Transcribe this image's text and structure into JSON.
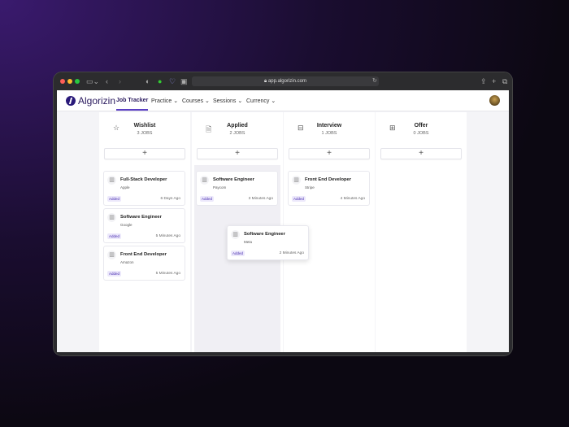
{
  "browser": {
    "url": "app.algorizin.com"
  },
  "nav": {
    "brand": "Algorizin",
    "items": [
      {
        "label": "Job Tracker"
      },
      {
        "label": "Practice ⌄"
      },
      {
        "label": "Courses ⌄"
      },
      {
        "label": "Sessions ⌄"
      },
      {
        "label": "Currency ⌄"
      }
    ]
  },
  "add_label": "+",
  "columns": [
    {
      "title": "Wishlist",
      "count": "3 JOBS",
      "icon": "star-icon",
      "cards": [
        {
          "title": "Full-Stack Developer",
          "company": "Apple",
          "badge": "Added",
          "time": "6 Days Ago"
        },
        {
          "title": "Software Engineer",
          "company": "Google",
          "badge": "Added",
          "time": "5 Minutes Ago"
        },
        {
          "title": "Front End Developer",
          "company": "Amazon",
          "badge": "Added",
          "time": "5 Minutes Ago"
        }
      ]
    },
    {
      "title": "Applied",
      "count": "2 JOBS",
      "icon": "document-icon",
      "cards": [
        {
          "title": "Software Engineer",
          "company": "Paycom",
          "badge": "Added",
          "time": "3 Minutes Ago"
        }
      ]
    },
    {
      "title": "Interview",
      "count": "1 JOBS",
      "icon": "briefcase-icon",
      "cards": [
        {
          "title": "Front End Developer",
          "company": "Stripe",
          "badge": "Added",
          "time": "4 Minutes Ago"
        }
      ]
    },
    {
      "title": "Offer",
      "count": "0 JOBS",
      "icon": "gift-icon",
      "cards": []
    }
  ],
  "dragging_card": {
    "title": "Software Engineer",
    "company": "Meta",
    "badge": "Added",
    "time": "2 Minutes Ago"
  }
}
